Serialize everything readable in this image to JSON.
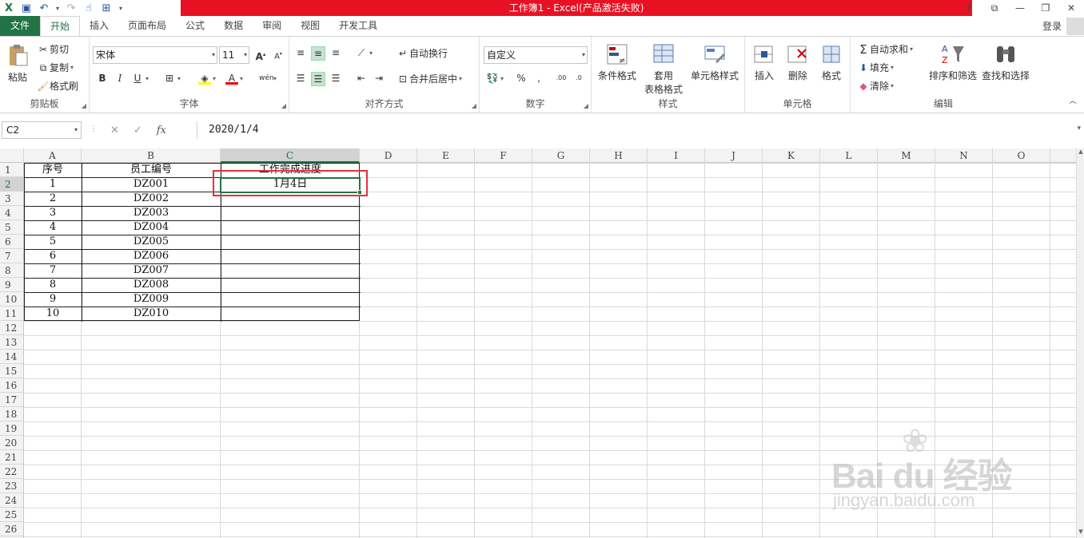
{
  "window": {
    "title": "工作簿1 - Excel(产品激活失败)",
    "controls": [
      "?",
      "⧉",
      "—",
      "❐",
      "✕"
    ]
  },
  "tabs": [
    "文件",
    "开始",
    "插入",
    "页面布局",
    "公式",
    "数据",
    "审阅",
    "视图",
    "开发工具"
  ],
  "active_tab": "开始",
  "login": "登录",
  "ribbon": {
    "clipboard": {
      "label": "剪贴板",
      "paste": "粘贴",
      "cut": "剪切",
      "copy": "复制",
      "format_painter": "格式刷"
    },
    "font": {
      "label": "字体",
      "font_name": "宋体",
      "font_size": "11"
    },
    "alignment": {
      "label": "对齐方式",
      "wrap_text": "自动换行",
      "merge_center": "合并后居中"
    },
    "number": {
      "label": "数字",
      "format": "自定义"
    },
    "styles": {
      "label": "样式",
      "conditional": "条件格式",
      "table_fmt_1": "套用",
      "table_fmt_2": "表格格式",
      "cell_styles": "单元格样式"
    },
    "cells": {
      "label": "单元格",
      "insert": "插入",
      "delete": "删除",
      "format": "格式"
    },
    "editing": {
      "label": "编辑",
      "autosum": "自动求和",
      "fill": "填充",
      "clear": "清除",
      "sort_filter": "排序和筛选",
      "find_select": "查找和选择"
    }
  },
  "formula_bar": {
    "name_box": "C2",
    "fx": "fx",
    "content": "2020/1/4"
  },
  "columns": [
    "A",
    "B",
    "C",
    "D",
    "E",
    "F",
    "G",
    "H",
    "I",
    "J",
    "K",
    "L",
    "M",
    "N",
    "O"
  ],
  "rows": [
    "1",
    "2",
    "3",
    "4",
    "5",
    "6",
    "7",
    "8",
    "9",
    "10",
    "11",
    "12",
    "13",
    "14",
    "15",
    "16",
    "17",
    "18",
    "19",
    "20",
    "21",
    "22",
    "23",
    "24",
    "25",
    "26"
  ],
  "selected_cell": "C2",
  "table": {
    "headers": [
      "序号",
      "员工编号",
      "工作完成进度"
    ],
    "rows": [
      [
        "1",
        "DZ001",
        "1月4日"
      ],
      [
        "2",
        "DZ002",
        ""
      ],
      [
        "3",
        "DZ003",
        ""
      ],
      [
        "4",
        "DZ004",
        ""
      ],
      [
        "5",
        "DZ005",
        ""
      ],
      [
        "6",
        "DZ006",
        ""
      ],
      [
        "7",
        "DZ007",
        ""
      ],
      [
        "8",
        "DZ008",
        ""
      ],
      [
        "9",
        "DZ009",
        ""
      ],
      [
        "10",
        "DZ010",
        ""
      ]
    ]
  },
  "watermark": {
    "brand": "Bai du 经验",
    "url": "jingyan.baidu.com"
  },
  "colors": {
    "excel_green": "#217346",
    "title_red": "#e81123",
    "highlight_red": "#e0333b"
  }
}
